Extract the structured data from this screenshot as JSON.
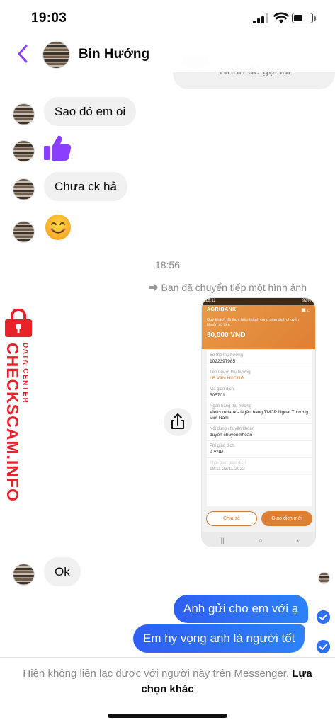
{
  "status_bar": {
    "time": "19:03",
    "icons": [
      "cellular-signal-icon",
      "wifi-icon",
      "battery-icon"
    ]
  },
  "header": {
    "contact_name": "Bin Hướng",
    "back_icon": "chevron-left-icon",
    "accent": "#8a3ffc"
  },
  "partial_message": {
    "text": "Nhấn để gọi lại"
  },
  "messages_in": [
    {
      "text": "Sao đó em oi"
    },
    {
      "emoji": "thumbs-up",
      "color": "#8a3ffc"
    },
    {
      "text": "Chưa ck hả"
    },
    {
      "emoji": "smiling-face"
    }
  ],
  "timestamp": "18:56",
  "forward_note": "Bạn đã chuyển tiếp một hình ảnh",
  "forwarded_image": {
    "status_time": "18:11",
    "status_right": "92%",
    "bank": "AGRIBANK",
    "message": "Quý khách đã thực hiện thành công giao dịch chuyển khoản số tiền",
    "amount": "50,000 VND",
    "fields": [
      {
        "label": "Số thẻ thụ hưởng",
        "value": "1022397985"
      },
      {
        "label": "Tên người thụ hưởng",
        "value": "LE VAN HUONG"
      },
      {
        "label": "Mã giao dịch",
        "value": "505701"
      },
      {
        "label": "Ngân hàng thụ hưởng",
        "value": "Vietcombank - Ngân hàng TMCP Ngoại Thương Việt Nam"
      },
      {
        "label": "Nội dung chuyển khoản",
        "value": "duyen chuyen khoan"
      },
      {
        "label": "Phí giao dịch",
        "value": "0 VND"
      },
      {
        "label": "Thời gian giao dịch",
        "value": "18:11 23/11/2022"
      }
    ],
    "share_btn": "Chia sẻ",
    "new_btn": "Giao dịch mới",
    "brand_color": "#df7f33"
  },
  "messages_in_2": [
    {
      "text": "Ok"
    }
  ],
  "messages_out": [
    {
      "text": "Anh gửi cho em với ạ"
    },
    {
      "text": "Em hy vọng anh là người tốt"
    }
  ],
  "watermark": {
    "main": "CHECKSCAM.INFO",
    "sub": "DATA CENTER",
    "color": "#e8222a"
  },
  "footer": {
    "note": "Hiện không liên lạc được với người này trên Messenger.",
    "link": "Lựa chọn khác"
  },
  "colors": {
    "outgoing": "#2d6ff5",
    "incoming": "#f0f0f0"
  }
}
